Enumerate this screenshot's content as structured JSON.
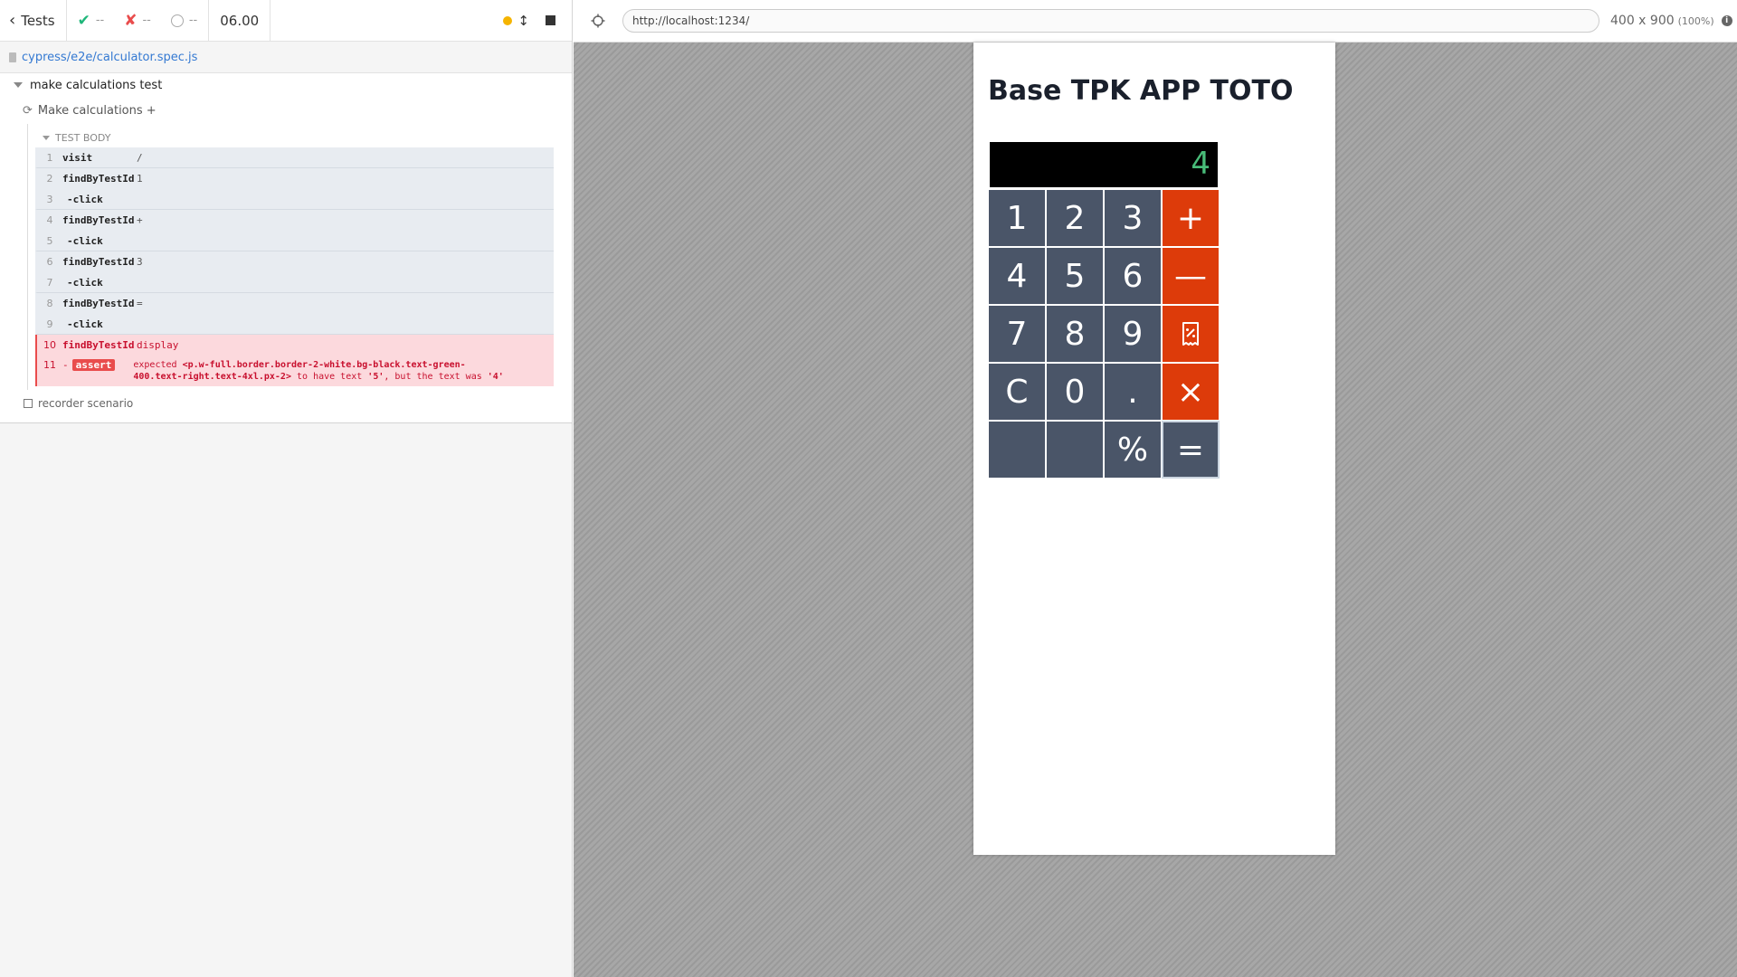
{
  "reporter": {
    "header": {
      "tests_label": "Tests",
      "passed": "--",
      "failed": "--",
      "pending": "--",
      "duration": "06.00"
    },
    "spec_path": "cypress/e2e/calculator.spec.js",
    "suite_title": "make calculations test",
    "test_title": "Make calculations +",
    "test_body_label": "TEST BODY",
    "commands": [
      {
        "num": "1",
        "name": "visit",
        "msg": "/"
      },
      {
        "num": "2",
        "name": "findByTestId",
        "msg": "1"
      },
      {
        "num": "3",
        "name": "-click",
        "msg": ""
      },
      {
        "num": "4",
        "name": "findByTestId",
        "msg": "+"
      },
      {
        "num": "5",
        "name": "-click",
        "msg": ""
      },
      {
        "num": "6",
        "name": "findByTestId",
        "msg": "3"
      },
      {
        "num": "7",
        "name": "-click",
        "msg": ""
      },
      {
        "num": "8",
        "name": "findByTestId",
        "msg": "="
      },
      {
        "num": "9",
        "name": "-click",
        "msg": ""
      },
      {
        "num": "10",
        "name": "findByTestId",
        "msg": "display"
      }
    ],
    "assert": {
      "num": "11",
      "dash": "-",
      "badge": "assert",
      "msg_prefix": "expected",
      "selector": "<p.w-full.border.border-2-white.bg-black.text-green-400.text-right.text-4xl.px-2>",
      "msg_mid": "to have text",
      "expected": "'5'",
      "msg_but": ", but the text was",
      "actual": "'4'"
    },
    "recorder_label": "recorder scenario"
  },
  "aut": {
    "url": "http://localhost:1234/",
    "viewport": "400 x 900",
    "viewport_pct": "(100%)",
    "app": {
      "title": "Base TPK APP TOTO",
      "display_value": "4",
      "keys": [
        "1",
        "2",
        "3",
        "+",
        "4",
        "5",
        "6",
        "—",
        "7",
        "8",
        "9",
        "",
        "C",
        "0",
        ".",
        "×",
        "",
        "",
        "%",
        "="
      ]
    }
  },
  "colors": {
    "operator": "#dd3b0a",
    "key": "#4a5568",
    "display_text": "#48bb78",
    "fail": "#e94c4c",
    "pass": "#1fb67a"
  }
}
